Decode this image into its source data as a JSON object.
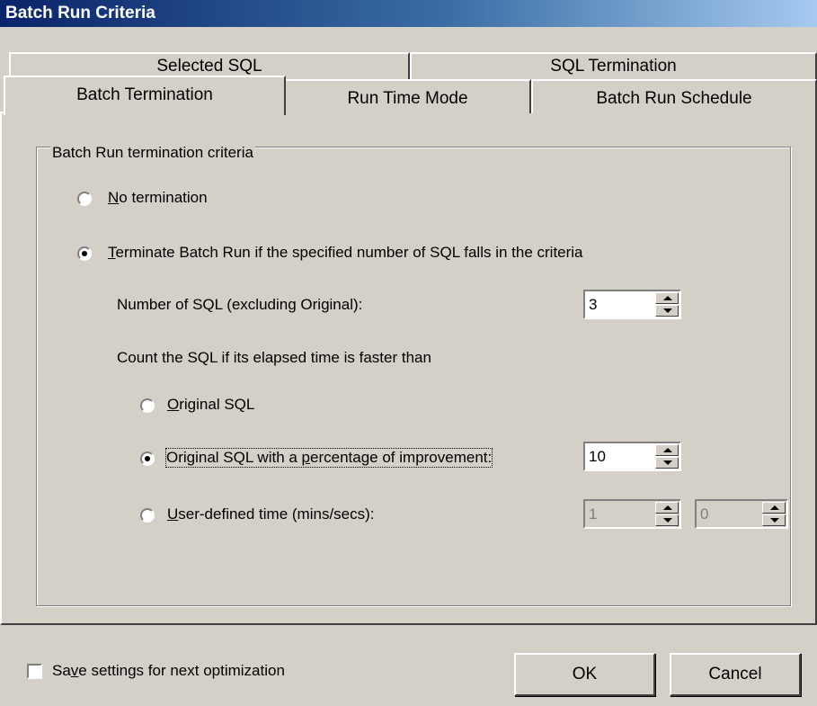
{
  "window": {
    "title": "Batch Run Criteria"
  },
  "tabs": {
    "row1": [
      {
        "label": "Selected SQL"
      },
      {
        "label": "SQL Termination"
      }
    ],
    "row2": [
      {
        "label": "Batch Termination",
        "selected": true
      },
      {
        "label": "Run Time Mode"
      },
      {
        "label": "Batch Run Schedule"
      }
    ]
  },
  "group": {
    "label": "Batch Run termination criteria",
    "options": {
      "no_termination": {
        "mnemonic": "N",
        "rest": "o termination",
        "checked": false
      },
      "terminate": {
        "mnemonic": "T",
        "rest": "erminate Batch Run if the specified number of SQL falls in the criteria",
        "checked": true
      }
    },
    "number_of_sql": {
      "label": "Number of SQL (excluding Original):",
      "value": "3"
    },
    "count_label": "Count the SQL if its elapsed time is faster than",
    "criteria": {
      "original": {
        "mnemonic": "O",
        "rest": "riginal SQL",
        "checked": false
      },
      "percentage": {
        "pre": "Original SQL with a ",
        "mnemonic": "p",
        "post": "ercentage of improvement:",
        "checked": true,
        "value": "10"
      },
      "user_defined": {
        "mnemonic": "U",
        "rest": "ser-defined time (mins/secs):",
        "checked": false,
        "mins": "1",
        "secs": "0"
      }
    }
  },
  "footer": {
    "save_pre": "Sa",
    "save_mnemonic": "v",
    "save_post": "e settings for next optimization",
    "save_checked": false,
    "ok_label": "OK",
    "cancel_label": "Cancel"
  }
}
